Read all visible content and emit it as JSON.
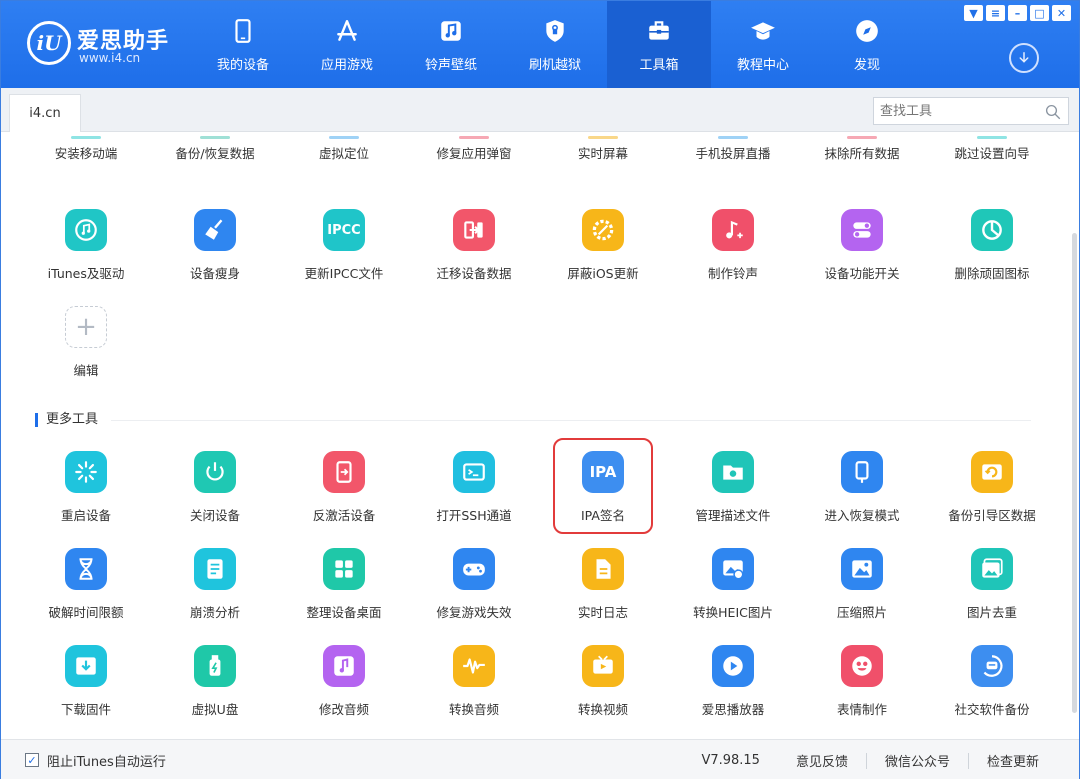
{
  "brand": {
    "name": "爱思助手",
    "url": "www.i4.cn",
    "logo_text": "iU"
  },
  "nav": [
    {
      "label": "我的设备",
      "icon": "phone-icon"
    },
    {
      "label": "应用游戏",
      "icon": "appstore-icon"
    },
    {
      "label": "铃声壁纸",
      "icon": "music-icon"
    },
    {
      "label": "刷机越狱",
      "icon": "shield-icon"
    },
    {
      "label": "工具箱",
      "icon": "toolbox-icon",
      "active": true
    },
    {
      "label": "教程中心",
      "icon": "graduation-icon"
    },
    {
      "label": "发现",
      "icon": "compass-icon"
    }
  ],
  "window_controls": [
    "skin-icon",
    "menu-icon",
    "minimize-icon",
    "maximize-icon",
    "close-icon"
  ],
  "tab": {
    "label": "i4.cn"
  },
  "search": {
    "placeholder": "查找工具"
  },
  "partial_row": [
    "安装移动端",
    "备份/恢复数据",
    "虚拟定位",
    "修复应用弹窗",
    "实时屏幕",
    "手机投屏直播",
    "抹除所有数据",
    "跳过设置向导"
  ],
  "my_tools": [
    {
      "label": "iTunes及驱动",
      "icon": "itunes-icon",
      "color": "#20c6c6"
    },
    {
      "label": "设备瘦身",
      "icon": "broom-icon",
      "color": "#2f86f0"
    },
    {
      "label": "更新IPCC文件",
      "icon": "ipcc-icon",
      "color": "#1fc5c9",
      "glyph": "IPCC"
    },
    {
      "label": "迁移设备数据",
      "icon": "transfer-icon",
      "color": "#f2566a"
    },
    {
      "label": "屏蔽iOS更新",
      "icon": "block-update-icon",
      "color": "#f7b619"
    },
    {
      "label": "制作铃声",
      "icon": "ringtone-icon",
      "color": "#f0506a"
    },
    {
      "label": "设备功能开关",
      "icon": "toggle-icon",
      "color": "#b464f0"
    },
    {
      "label": "删除顽固图标",
      "icon": "pie-icon",
      "color": "#1fc7b8"
    }
  ],
  "edit": {
    "label": "编辑",
    "glyph": "+"
  },
  "more_tools_title": "更多工具",
  "more_tools": [
    {
      "label": "重启设备",
      "icon": "restart-icon",
      "color": "#1fc4dd"
    },
    {
      "label": "关闭设备",
      "icon": "power-icon",
      "color": "#1fc8b3"
    },
    {
      "label": "反激活设备",
      "icon": "deactivate-icon",
      "color": "#f2566a"
    },
    {
      "label": "打开SSH通道",
      "icon": "terminal-icon",
      "color": "#20bfe0"
    },
    {
      "label": "IPA签名",
      "icon": "ipa-icon",
      "color": "#3d8ef0",
      "glyph": "IPA"
    },
    {
      "label": "管理描述文件",
      "icon": "profile-icon",
      "color": "#1fc5b8"
    },
    {
      "label": "进入恢复模式",
      "icon": "recovery-icon",
      "color": "#2f86f0"
    },
    {
      "label": "备份引导区数据",
      "icon": "backup-boot-icon",
      "color": "#f7b619"
    },
    {
      "label": "破解时间限额",
      "icon": "hourglass-icon",
      "color": "#2f86f0"
    },
    {
      "label": "崩溃分析",
      "icon": "crash-log-icon",
      "color": "#1fc4dd"
    },
    {
      "label": "整理设备桌面",
      "icon": "grid-icon",
      "color": "#1fc8a8"
    },
    {
      "label": "修复游戏失效",
      "icon": "gamepad-icon",
      "color": "#2f86f0"
    },
    {
      "label": "实时日志",
      "icon": "log-icon",
      "color": "#f7b619"
    },
    {
      "label": "转换HEIC图片",
      "icon": "heic-icon",
      "color": "#2f86f0"
    },
    {
      "label": "压缩照片",
      "icon": "compress-photo-icon",
      "color": "#2f86f0"
    },
    {
      "label": "图片去重",
      "icon": "dedupe-icon",
      "color": "#1fc5b8"
    },
    {
      "label": "下载固件",
      "icon": "download-firmware-icon",
      "color": "#1fc4dd"
    },
    {
      "label": "虚拟U盘",
      "icon": "usb-icon",
      "color": "#1fc8a8"
    },
    {
      "label": "修改音频",
      "icon": "edit-audio-icon",
      "color": "#b464f0"
    },
    {
      "label": "转换音频",
      "icon": "audio-wave-icon",
      "color": "#f7b619"
    },
    {
      "label": "转换视频",
      "icon": "video-icon",
      "color": "#f7b619"
    },
    {
      "label": "爱思播放器",
      "icon": "player-icon",
      "color": "#2f86f0"
    },
    {
      "label": "表情制作",
      "icon": "emoji-icon",
      "color": "#f0506a"
    },
    {
      "label": "社交软件备份",
      "icon": "chat-backup-icon",
      "color": "#3d8ef0"
    }
  ],
  "status": {
    "checkbox_label": "阻止iTunes自动运行",
    "checked": true,
    "version": "V7.98.15",
    "feedback": "意见反馈",
    "wechat": "微信公众号",
    "update": "检查更新"
  }
}
